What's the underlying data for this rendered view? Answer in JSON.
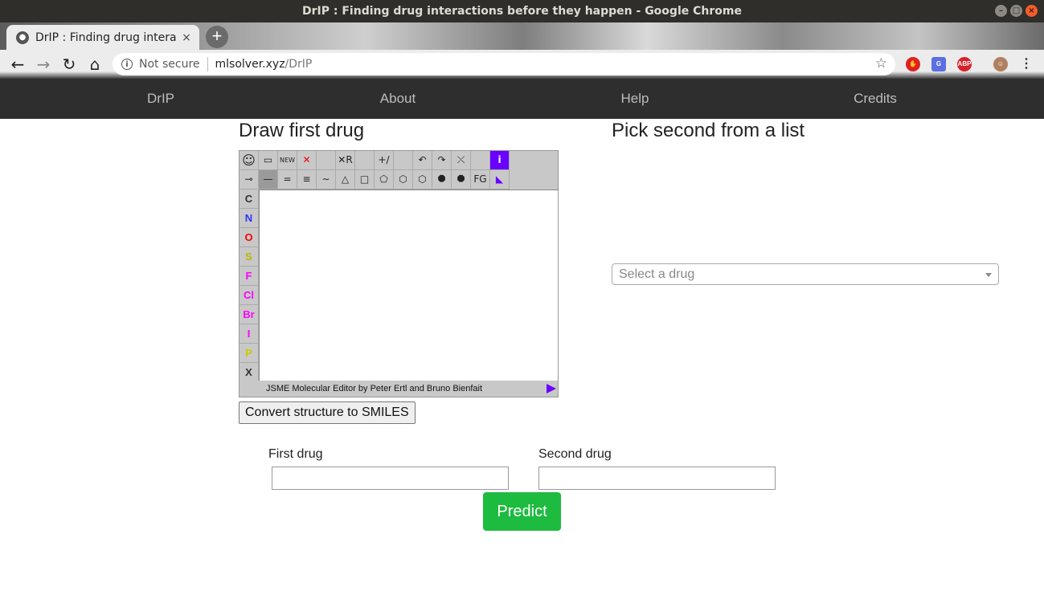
{
  "window": {
    "title": "DrIP : Finding drug interactions before they happen - Google Chrome"
  },
  "tab": {
    "title": "DrIP : Finding drug intera",
    "close": "×",
    "new": "+"
  },
  "toolbar": {
    "back": "←",
    "forward": "→",
    "reload": "↻",
    "home": "⌂",
    "security": "Not secure",
    "url_host": "mlsolver.xyz",
    "url_path": "/DrIP",
    "extensions": [
      "stop-icon",
      "translate-icon",
      "adblock-icon",
      "profile-avatar",
      "menu-icon"
    ],
    "adblock_label": "ABP"
  },
  "sitenav": {
    "items": [
      "DrIP",
      "About",
      "Help",
      "Credits"
    ]
  },
  "left": {
    "heading": "Draw first drug",
    "jsme": {
      "row1": [
        "☺",
        "▭",
        "NEW",
        "✕",
        "",
        "✕R",
        "",
        "+/−",
        "",
        "↶",
        "↷",
        "⤬",
        "",
        "i"
      ],
      "row2": [
        "⊸",
        "—",
        "=",
        "≡",
        "∼",
        "△",
        "□",
        "⬠",
        "⬡",
        "⬡",
        "⯃",
        "⯃",
        "FG",
        "◣"
      ],
      "atoms": [
        {
          "symbol": "C",
          "color": "#333333"
        },
        {
          "symbol": "N",
          "color": "#3333ff"
        },
        {
          "symbol": "O",
          "color": "#ff0000"
        },
        {
          "symbol": "S",
          "color": "#b8b800"
        },
        {
          "symbol": "F",
          "color": "#ff00ff"
        },
        {
          "symbol": "Cl",
          "color": "#ff00ff"
        },
        {
          "symbol": "Br",
          "color": "#ff00ff"
        },
        {
          "symbol": "I",
          "color": "#ff00ff"
        },
        {
          "symbol": "P",
          "color": "#cccc00"
        },
        {
          "symbol": "X",
          "color": "#333333"
        }
      ],
      "footer": "JSME Molecular Editor by Peter Ertl and Bruno Bienfait"
    },
    "convert_button": "Convert structure to SMILES"
  },
  "right": {
    "heading": "Pick second from a list",
    "select_placeholder": "Select a drug"
  },
  "form": {
    "first_label": "First drug",
    "second_label": "Second drug",
    "first_value": "",
    "second_value": "",
    "predict_button": "Predict"
  },
  "colors": {
    "nav_bg": "#2e2e2e",
    "predict": "#1dbb3f",
    "jsme_accent": "#6a00ff"
  }
}
